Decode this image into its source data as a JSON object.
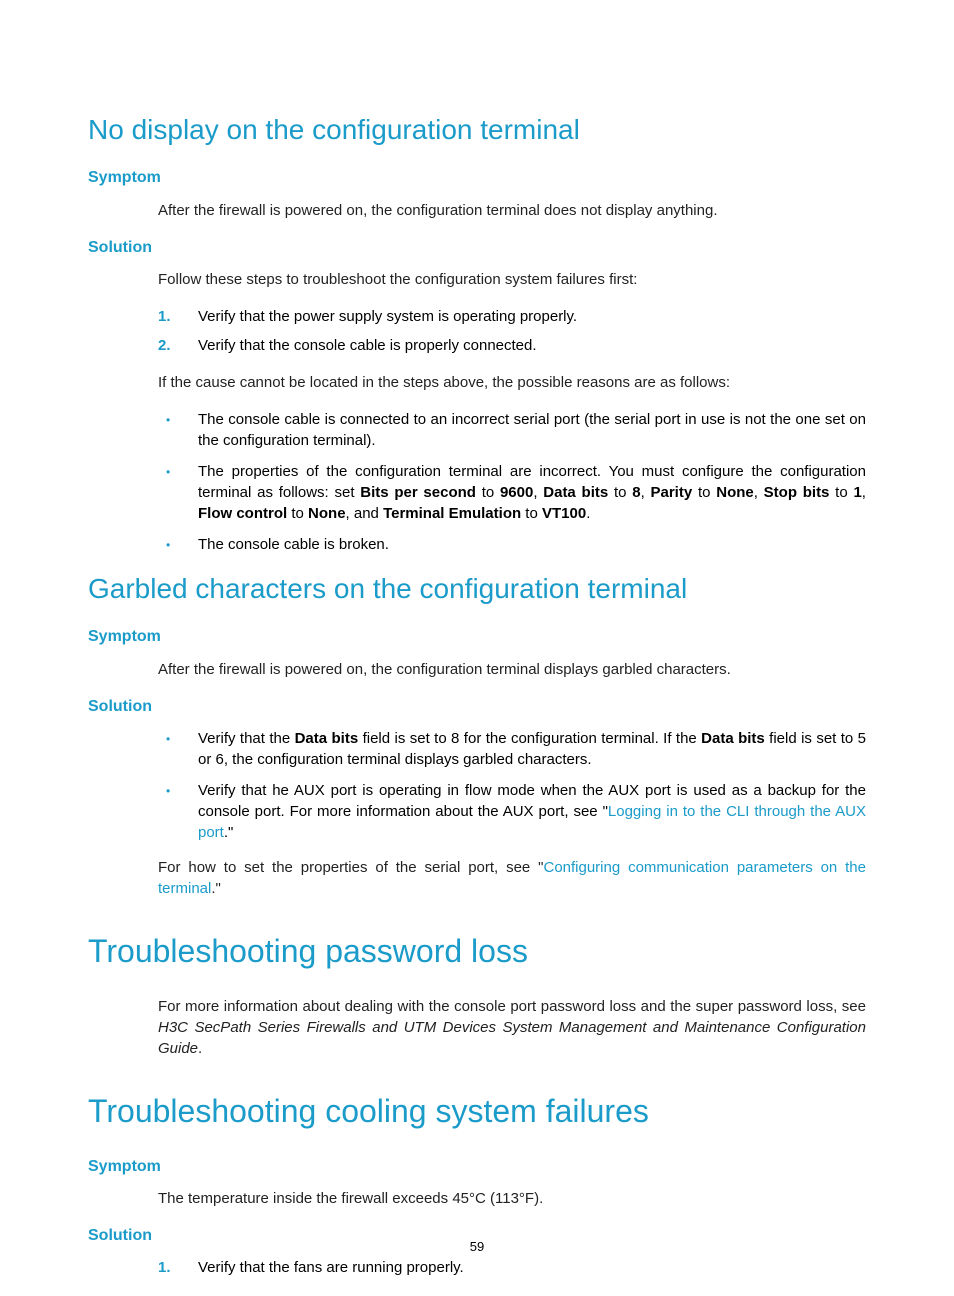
{
  "sec1": {
    "title": "No display on the configuration terminal",
    "symptom_label": "Symptom",
    "symptom_text": "After the firewall is powered on, the configuration terminal does not display anything.",
    "solution_label": "Solution",
    "sol_intro": "Follow these steps to troubleshoot the configuration system failures first:",
    "step1_num": "1.",
    "step1": "Verify that the power supply system is operating properly.",
    "step2_num": "2.",
    "step2": "Verify that the console cable is properly connected.",
    "sol_mid": "If the cause cannot be located in the steps above, the possible reasons are as follows:",
    "b1": "The console cable is connected to an incorrect serial port (the serial port in use is not the one set on the configuration terminal).",
    "b2_a": "The properties of the configuration terminal are incorrect. You must configure the configuration terminal as follows: set ",
    "b2_bps": "Bits per second",
    "b2_to1": " to ",
    "b2_9600": "9600",
    "b2_c1": ", ",
    "b2_db": "Data bits",
    "b2_to2": " to ",
    "b2_8": "8",
    "b2_c2": ", ",
    "b2_par": "Parity",
    "b2_to3": " to ",
    "b2_none1": "None",
    "b2_c3": ", ",
    "b2_sb": "Stop bits",
    "b2_to4": " to ",
    "b2_1": "1",
    "b2_c4": ", ",
    "b2_fc": "Flow control",
    "b2_to5": " to ",
    "b2_none2": "None",
    "b2_and": ", and ",
    "b2_te": "Terminal Emulation",
    "b2_to6": " to ",
    "b2_vt": "VT100",
    "b2_end": ".",
    "b3": "The console cable is broken."
  },
  "sec2": {
    "title": "Garbled characters on the configuration terminal",
    "symptom_label": "Symptom",
    "symptom_text": "After the firewall is powered on, the configuration terminal displays garbled characters.",
    "solution_label": "Solution",
    "b1_a": "Verify that the ",
    "b1_db1": "Data bits",
    "b1_b": " field is set to 8 for the configuration terminal. If the ",
    "b1_db2": "Data bits",
    "b1_c": " field is set to 5 or 6, the configuration terminal displays garbled characters.",
    "b2_a": "Verify that he AUX port is operating in flow mode when the AUX port is used as a backup for the console port. For more information about the AUX port, see \"",
    "b2_link": "Logging in to the CLI through the AUX port",
    "b2_b": ".\"",
    "p_a": "For how to set the properties of the serial port, see \"",
    "p_link": "Configuring communication parameters on the terminal",
    "p_b": ".\""
  },
  "sec3": {
    "title": "Troubleshooting password loss",
    "p_a": "For more information about dealing with the console port password loss and the super password loss, see ",
    "p_i": "H3C SecPath Series Firewalls and UTM Devices System Management and Maintenance Configuration Guide",
    "p_b": "."
  },
  "sec4": {
    "title": "Troubleshooting cooling system failures",
    "symptom_label": "Symptom",
    "symptom_text": "The temperature inside the firewall exceeds 45°C (113°F).",
    "solution_label": "Solution",
    "step1_num": "1.",
    "step1": "Verify that the fans are running properly."
  },
  "page_number": "59"
}
